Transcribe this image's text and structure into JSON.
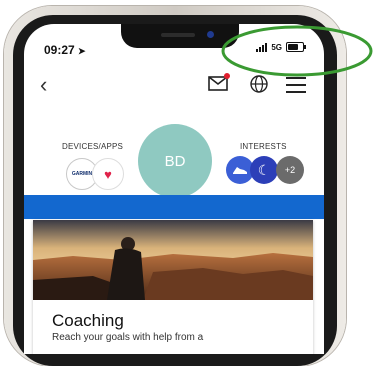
{
  "status_bar": {
    "time": "09:27",
    "network": "5G",
    "battery_level": 0.7
  },
  "profile": {
    "devices_label": "DEVICES/APPS",
    "interests_label": "INTERESTS",
    "avatar_initials": "BD",
    "device_brand": "GARMIN",
    "more_interests": "+2"
  },
  "card": {
    "title": "Coaching",
    "description": "Reach your goals with help from a"
  },
  "colors": {
    "avatar": "#8fc9c1",
    "brand_blue": "#1368cf",
    "annotation_green": "#3a9a32",
    "interest_blue": "#3b5fd6"
  }
}
